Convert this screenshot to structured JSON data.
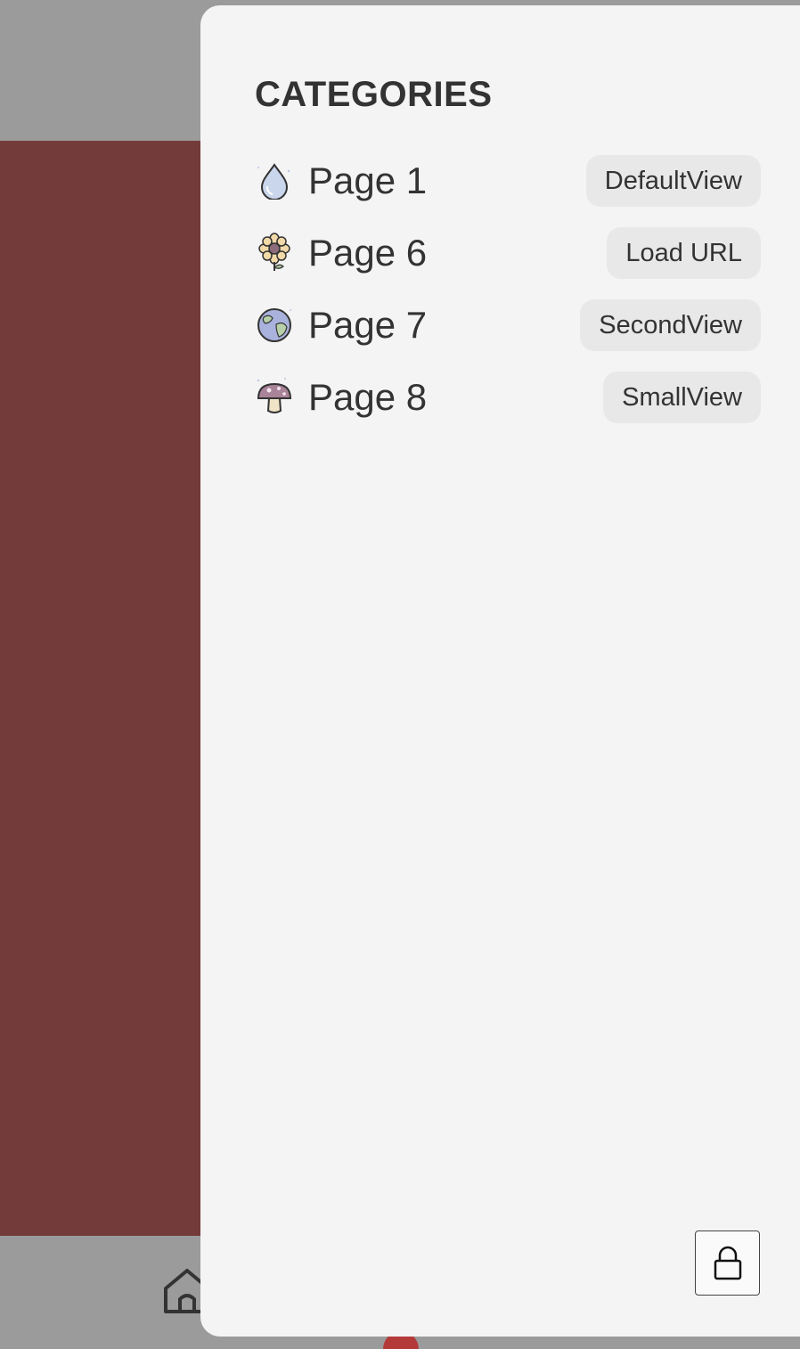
{
  "drawer": {
    "title": "CATEGORIES",
    "items": [
      {
        "label": "Page 1",
        "icon": "water-drop-icon",
        "view_label": "DefaultView"
      },
      {
        "label": "Page 6",
        "icon": "sunflower-icon",
        "view_label": "Load URL"
      },
      {
        "label": "Page 7",
        "icon": "earth-globe-icon",
        "view_label": "SecondView"
      },
      {
        "label": "Page 8",
        "icon": "mushroom-icon",
        "view_label": "SmallView"
      }
    ],
    "lock_icon": "lock-icon"
  },
  "bottom_nav": {
    "home_icon": "home-icon"
  },
  "colors": {
    "overlay_gray": "#9b9b9b",
    "content_bg": "#733b3a",
    "drawer_bg": "#f4f4f4",
    "pill_bg": "#e8e8e8",
    "text": "#333333"
  }
}
